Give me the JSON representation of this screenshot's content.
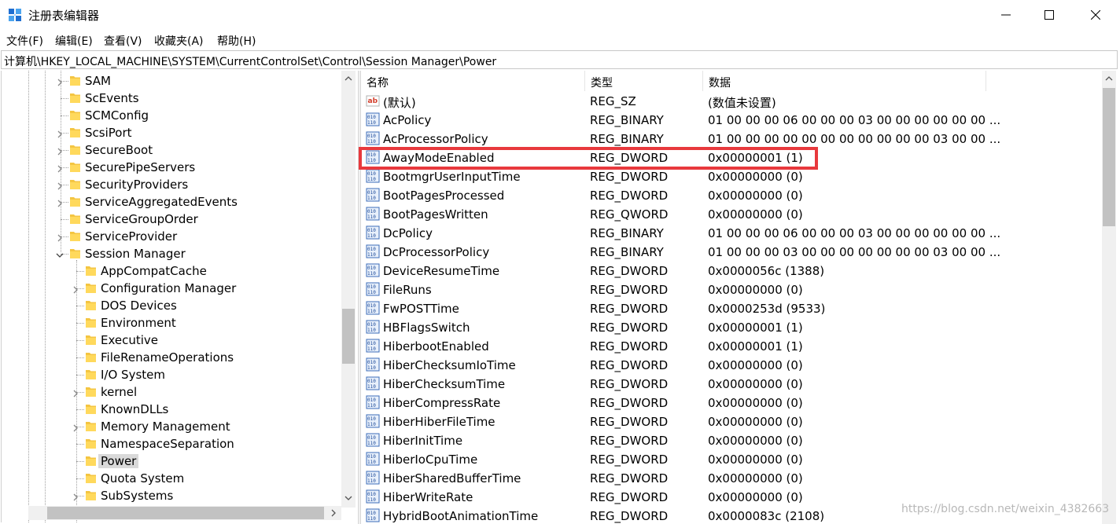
{
  "window": {
    "title": "注册表编辑器",
    "minimize_icon": "minimize-icon",
    "maximize_icon": "maximize-icon",
    "close_icon": "close-icon"
  },
  "menu": [
    {
      "label": "文件(F)"
    },
    {
      "label": "编辑(E)"
    },
    {
      "label": "查看(V)"
    },
    {
      "label": "收藏夹(A)"
    },
    {
      "label": "帮助(H)"
    }
  ],
  "address": "计算机\\HKEY_LOCAL_MACHINE\\SYSTEM\\CurrentControlSet\\Control\\Session Manager\\Power",
  "tree": {
    "items": [
      {
        "label": "SAM",
        "level": 1,
        "expander": "collapsed"
      },
      {
        "label": "ScEvents",
        "level": 1,
        "expander": "none"
      },
      {
        "label": "SCMConfig",
        "level": 1,
        "expander": "none"
      },
      {
        "label": "ScsiPort",
        "level": 1,
        "expander": "collapsed"
      },
      {
        "label": "SecureBoot",
        "level": 1,
        "expander": "collapsed"
      },
      {
        "label": "SecurePipeServers",
        "level": 1,
        "expander": "collapsed"
      },
      {
        "label": "SecurityProviders",
        "level": 1,
        "expander": "collapsed"
      },
      {
        "label": "ServiceAggregatedEvents",
        "level": 1,
        "expander": "collapsed"
      },
      {
        "label": "ServiceGroupOrder",
        "level": 1,
        "expander": "none"
      },
      {
        "label": "ServiceProvider",
        "level": 1,
        "expander": "collapsed"
      },
      {
        "label": "Session Manager",
        "level": 1,
        "expander": "expanded"
      },
      {
        "label": "AppCompatCache",
        "level": 2,
        "expander": "none"
      },
      {
        "label": "Configuration Manager",
        "level": 2,
        "expander": "collapsed"
      },
      {
        "label": "DOS Devices",
        "level": 2,
        "expander": "none"
      },
      {
        "label": "Environment",
        "level": 2,
        "expander": "none"
      },
      {
        "label": "Executive",
        "level": 2,
        "expander": "none"
      },
      {
        "label": "FileRenameOperations",
        "level": 2,
        "expander": "none"
      },
      {
        "label": "I/O System",
        "level": 2,
        "expander": "none"
      },
      {
        "label": "kernel",
        "level": 2,
        "expander": "collapsed"
      },
      {
        "label": "KnownDLLs",
        "level": 2,
        "expander": "none"
      },
      {
        "label": "Memory Management",
        "level": 2,
        "expander": "collapsed"
      },
      {
        "label": "NamespaceSeparation",
        "level": 2,
        "expander": "none"
      },
      {
        "label": "Power",
        "level": 2,
        "expander": "none",
        "selected": true
      },
      {
        "label": "Quota System",
        "level": 2,
        "expander": "none"
      },
      {
        "label": "SubSystems",
        "level": 2,
        "expander": "collapsed"
      }
    ]
  },
  "list": {
    "headers": {
      "name": "名称",
      "type": "类型",
      "data": "数据"
    },
    "rows": [
      {
        "name": "(默认)",
        "type": "REG_SZ",
        "data": "(数值未设置)",
        "icon": "string-value-icon"
      },
      {
        "name": "AcPolicy",
        "type": "REG_BINARY",
        "data": "01 00 00 00 06 00 00 00 03 00 00 00 00 00 00 ...",
        "icon": "binary-value-icon"
      },
      {
        "name": "AcProcessorPolicy",
        "type": "REG_BINARY",
        "data": "01 00 00 00 00 00 00 00 00 00 00 00 03 00 00 ...",
        "icon": "binary-value-icon"
      },
      {
        "name": "AwayModeEnabled",
        "type": "REG_DWORD",
        "data": "0x00000001 (1)",
        "icon": "binary-value-icon",
        "highlighted": true
      },
      {
        "name": "BootmgrUserInputTime",
        "type": "REG_DWORD",
        "data": "0x00000000 (0)",
        "icon": "binary-value-icon"
      },
      {
        "name": "BootPagesProcessed",
        "type": "REG_DWORD",
        "data": "0x00000000 (0)",
        "icon": "binary-value-icon"
      },
      {
        "name": "BootPagesWritten",
        "type": "REG_QWORD",
        "data": "0x00000000 (0)",
        "icon": "binary-value-icon"
      },
      {
        "name": "DcPolicy",
        "type": "REG_BINARY",
        "data": "01 00 00 00 06 00 00 00 03 00 00 00 00 00 00 ...",
        "icon": "binary-value-icon"
      },
      {
        "name": "DcProcessorPolicy",
        "type": "REG_BINARY",
        "data": "01 00 00 00 03 00 00 00 00 00 00 00 03 00 00 ...",
        "icon": "binary-value-icon"
      },
      {
        "name": "DeviceResumeTime",
        "type": "REG_DWORD",
        "data": "0x0000056c (1388)",
        "icon": "binary-value-icon"
      },
      {
        "name": "FileRuns",
        "type": "REG_DWORD",
        "data": "0x00000000 (0)",
        "icon": "binary-value-icon"
      },
      {
        "name": "FwPOSTTime",
        "type": "REG_DWORD",
        "data": "0x0000253d (9533)",
        "icon": "binary-value-icon"
      },
      {
        "name": "HBFlagsSwitch",
        "type": "REG_DWORD",
        "data": "0x00000001 (1)",
        "icon": "binary-value-icon"
      },
      {
        "name": "HiberbootEnabled",
        "type": "REG_DWORD",
        "data": "0x00000001 (1)",
        "icon": "binary-value-icon"
      },
      {
        "name": "HiberChecksumIoTime",
        "type": "REG_DWORD",
        "data": "0x00000000 (0)",
        "icon": "binary-value-icon"
      },
      {
        "name": "HiberChecksumTime",
        "type": "REG_DWORD",
        "data": "0x00000000 (0)",
        "icon": "binary-value-icon"
      },
      {
        "name": "HiberCompressRate",
        "type": "REG_DWORD",
        "data": "0x00000000 (0)",
        "icon": "binary-value-icon"
      },
      {
        "name": "HiberHiberFileTime",
        "type": "REG_DWORD",
        "data": "0x00000000 (0)",
        "icon": "binary-value-icon"
      },
      {
        "name": "HiberInitTime",
        "type": "REG_DWORD",
        "data": "0x00000000 (0)",
        "icon": "binary-value-icon"
      },
      {
        "name": "HiberIoCpuTime",
        "type": "REG_DWORD",
        "data": "0x00000000 (0)",
        "icon": "binary-value-icon"
      },
      {
        "name": "HiberSharedBufferTime",
        "type": "REG_DWORD",
        "data": "0x00000000 (0)",
        "icon": "binary-value-icon"
      },
      {
        "name": "HiberWriteRate",
        "type": "REG_DWORD",
        "data": "0x00000000 (0)",
        "icon": "binary-value-icon"
      },
      {
        "name": "HybridBootAnimationTime",
        "type": "REG_DWORD",
        "data": "0x0000083c (2108)",
        "icon": "binary-value-icon"
      }
    ]
  },
  "watermark": "https://blog.csdn.net/weixin_4382663",
  "colors": {
    "highlight_border": "#e8393d",
    "folder": "#f4c542",
    "selection": "#d9d9d9"
  }
}
